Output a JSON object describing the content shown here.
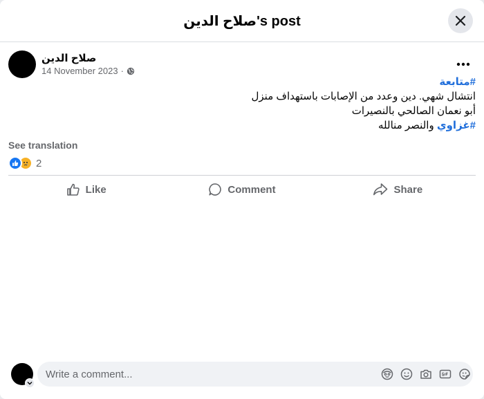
{
  "header": {
    "title": "صلاح الدين's post"
  },
  "post": {
    "author": "صلاح الدين",
    "date": "14 November 2023",
    "separator": "·",
    "lines": [
      "#متابعة",
      "انتشال شهي. دين وعدد من الإصابات باستهداف منزل",
      "أبو نعمان الصالحي بالنصيرات",
      "والنصر منالله"
    ],
    "hashtag_last": "#غزاوي",
    "see_translation": "See translation",
    "reaction_count": "2"
  },
  "actions": {
    "like": "Like",
    "comment": "Comment",
    "share": "Share"
  },
  "comment_box": {
    "placeholder": "Write a comment..."
  },
  "icons": {
    "close": "close-icon",
    "more": "more-icon",
    "globe": "globe-icon",
    "like": "thumbs-up-icon",
    "comment": "comment-bubble-icon",
    "share": "share-arrow-icon",
    "avatar_sticker": "avatar-sticker-icon",
    "emoji": "emoji-icon",
    "camera": "camera-icon",
    "gif": "gif-icon",
    "sticker": "sticker-icon"
  },
  "colors": {
    "accent": "#216fdb",
    "like_blue": "#1877f2",
    "sad_yellow": "#f7b125",
    "muted": "#65676b"
  }
}
